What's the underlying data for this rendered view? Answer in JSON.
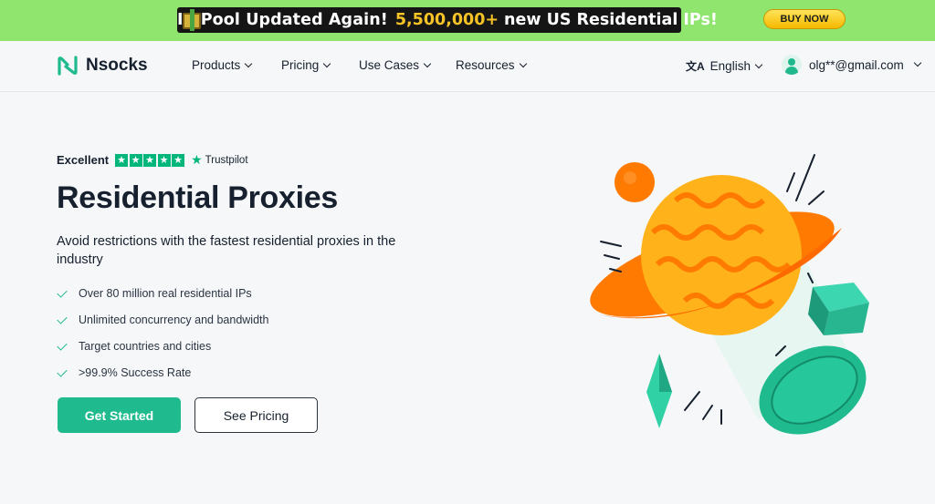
{
  "promo": {
    "text": "IP Pool Updated Again!",
    "highlight": "5,500,000+",
    "text2": "new US Residential IPs!",
    "cta": "BUY NOW"
  },
  "nav": {
    "brand": "Nsocks",
    "items": [
      {
        "label": "Products"
      },
      {
        "label": "Pricing"
      },
      {
        "label": "Use Cases"
      },
      {
        "label": "Resources"
      }
    ],
    "language": "English",
    "user_email": "olg**@gmail.com"
  },
  "hero": {
    "rating_label": "Excellent",
    "rating_stars": 5,
    "rating_source": "Trustpilot",
    "title": "Residential Proxies",
    "subtitle": "Avoid restrictions with the fastest residential proxies in the industry",
    "features": [
      "Over 80 million real residential IPs",
      "Unlimited concurrency and bandwidth",
      "Target countries and cities",
      ">99.9% Success Rate"
    ],
    "primary_cta": "Get Started",
    "secondary_cta": "See Pricing"
  },
  "colors": {
    "promo_bg": "#8fe56e",
    "accent": "#1fbb8f",
    "trustpilot": "#00b67a",
    "planet_orange": "#ff7a00",
    "planet_yellow": "#ffb21a",
    "cube_teal": "#3cd6b0"
  }
}
